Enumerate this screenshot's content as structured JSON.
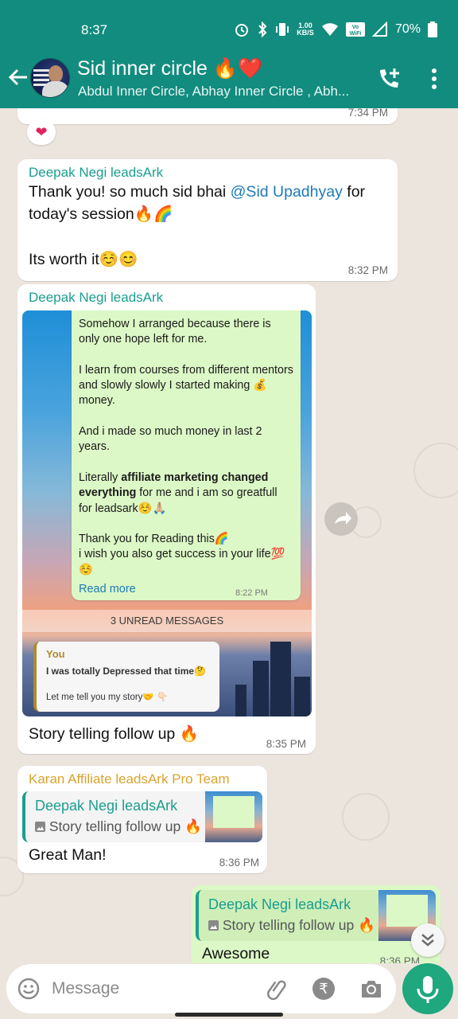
{
  "status_bar": {
    "time": "8:37",
    "speed": "1.00\nKB/S",
    "battery": "70%",
    "icons": [
      "alarm-icon",
      "bluetooth-icon",
      "vibrate-icon",
      "data-speed",
      "vowifi-icon",
      "signal-icon",
      "battery-icon"
    ]
  },
  "header": {
    "title": "Sid inner circle 🔥❤️",
    "subtitle": "Abdul Inner Circle, Abhay Inner Circle , Abh...",
    "icons": [
      "back-arrow-icon",
      "add-call-icon",
      "more-vert-icon"
    ]
  },
  "messages": {
    "top_partial_time": "7:34 PM",
    "top_reaction": "❤",
    "m1": {
      "sender": "Deepak Negi leadsArk",
      "sender_color": "#1b9e8e",
      "line1_pre": "Thank you! so much sid bhai ",
      "line1_mention": "@Sid Upadhyay",
      "line1_post": " for",
      "line2": "today's session🔥🌈",
      "line3": "Its worth it☺️😊",
      "time": "8:32 PM"
    },
    "m2": {
      "sender": "Deepak Negi leadsArk",
      "image": {
        "para1": "Somehow I arranged because there is only one hope left for me.",
        "para2_pre": "I learn from courses from different mentors and slowly slowly I started making ",
        "para2_post": " money.",
        "money_emoji": "💰",
        "para3": "And i made so much money in last 2 years.",
        "para4_pre": "Literally ",
        "para4_bold": "affiliate marketing changed everything",
        "para4_post": " for me and i am so greatfull for leadsark☺️🙏🏼",
        "para5": "Thank you for Reading this🌈",
        "para6": "i wish you also get success in your life💯 ☺️",
        "read_more": "Read more",
        "inner_time": "8:22 PM",
        "unread": "3 UNREAD MESSAGES",
        "quote_name": "You",
        "quote_line1": "I was totally Depressed that time🤔",
        "quote_line2": "Let me tell you my story🤝 👇🏻"
      },
      "caption": "Story telling follow up 🔥",
      "time": "8:35 PM"
    },
    "m3": {
      "sender": "Karan Affiliate leadsArk Pro Team",
      "sender_color": "#d9a42f",
      "reply_name": "Deepak Negi leadsArk",
      "reply_text": "Story telling follow up 🔥",
      "text": "Great Man!",
      "time": "8:36 PM"
    },
    "m4": {
      "reply_name": "Deepak Negi leadsArk",
      "reply_text": "Story telling follow up 🔥",
      "text": "Awesome",
      "time": "8:36 PM"
    }
  },
  "composer": {
    "placeholder": "Message",
    "rupee_symbol": "₹",
    "icons": [
      "emoji-icon",
      "attach-icon",
      "payment-icon",
      "camera-icon",
      "mic-icon"
    ]
  }
}
